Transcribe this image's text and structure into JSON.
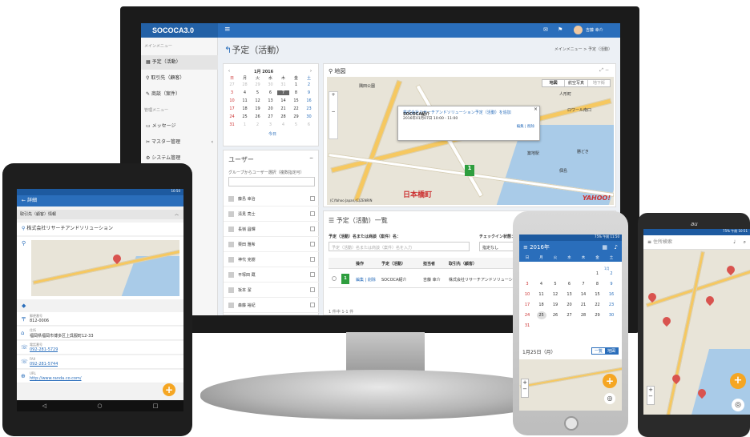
{
  "desktop": {
    "app_title": "SOCOCA3.0",
    "menu_icon": "hamburger-icon",
    "user_name": "吉藤 幸介",
    "page_title": "予定（活動）",
    "breadcrumb": "メインメニュー > 予定（活動）",
    "sidebar": {
      "section_main": "メインメニュー",
      "items": [
        {
          "icon": "calendar-icon",
          "label": "予定（活動）"
        },
        {
          "icon": "map-pin-icon",
          "label": "取引先（顧客）"
        },
        {
          "icon": "edit-icon",
          "label": "商談（案件）"
        }
      ],
      "section_admin": "管理メニュー",
      "admin_items": [
        {
          "icon": "inbox-icon",
          "label": "メッセージ"
        },
        {
          "icon": "wrench-icon",
          "label": "マスター管理"
        },
        {
          "icon": "gear-icon",
          "label": "システム管理"
        }
      ]
    },
    "calendar": {
      "month": "1月 2016",
      "weekdays": [
        "日",
        "月",
        "火",
        "水",
        "木",
        "金",
        "土"
      ],
      "weeks": [
        [
          "27",
          "28",
          "29",
          "30",
          "31",
          "1",
          "2"
        ],
        [
          "3",
          "4",
          "5",
          "6",
          "7",
          "8",
          "9"
        ],
        [
          "10",
          "11",
          "12",
          "13",
          "14",
          "15",
          "16"
        ],
        [
          "17",
          "18",
          "19",
          "20",
          "21",
          "22",
          "23"
        ],
        [
          "24",
          "25",
          "26",
          "27",
          "28",
          "29",
          "30"
        ],
        [
          "31",
          "1",
          "2",
          "3",
          "4",
          "5",
          "6"
        ]
      ],
      "today": "今日"
    },
    "users": {
      "title": "ユーザー",
      "group_label": "グループからユーザー選択（複数指定可）",
      "names": [
        "藤島 幸治",
        "清見 亮士",
        "長嶺 昌輝",
        "栗田 雅希",
        "神代 克樹",
        "平塚田 蔵",
        "坂本 潔",
        "森藤 裕紀"
      ]
    },
    "map": {
      "title": "地図",
      "map_btn": "地図",
      "satellite_btn": "航空写真",
      "terrain_btn": "地下街",
      "popup_company": "株式会社リサーチアンドソリューション予定（活動）を追加",
      "popup_time": "2016年01月07日 10:00 - 11:00",
      "popup_event": "SOCOCA紹介",
      "popup_actions": "編集 | 削除",
      "credit": "(C)Yahoo Japan,(C)ZENRIN",
      "landmark": "日本橋町",
      "brand": "YAHOO!",
      "labels": [
        "人形町",
        "ロワール南口",
        "築地駅",
        "勝どき",
        "佃島",
        "隅田公園"
      ],
      "marker_label": "1"
    },
    "list": {
      "title": "予定（活動）一覧",
      "search_label": "予定（活動）名または商談（案件）名：",
      "search_placeholder": "予定（活動）名または商談（案件）名を入力",
      "checkin_label": "チェックイン状態：",
      "checkin_value": "指定なし",
      "columns": [
        "操作",
        "予定（活動）",
        "担当者",
        "取引先（顧客）"
      ],
      "row": {
        "marker": "1",
        "actions": "編集 | 削除",
        "event": "SOCOCA紹介",
        "owner": "吉藤 幸介",
        "customer": "株式会社リサーチアンドソリューション"
      },
      "footer": "1 件中 1-1 件"
    }
  },
  "tablet": {
    "status": "10:50",
    "header": "詳細",
    "section": "取引先（顧客）情報",
    "company": "株式会社リサーチアンドソリューション",
    "fields": [
      {
        "icon": "postal-icon",
        "label": "郵便番号",
        "value": "812-0006"
      },
      {
        "icon": "address-icon",
        "label": "住所",
        "value": "福岡県福岡市博多区上呉服町12-33"
      },
      {
        "icon": "phone-icon",
        "label": "電話番号",
        "value": "092-281-5729"
      },
      {
        "icon": "fax-icon",
        "label": "FAX",
        "value": "092-281-5744"
      },
      {
        "icon": "url-icon",
        "label": "URL",
        "value": "http://www.randa.co.com/"
      }
    ]
  },
  "iphone": {
    "status": "75% 午前 11:50",
    "year": "2016年",
    "weekdays": [
      "日",
      "月",
      "火",
      "水",
      "木",
      "金",
      "土"
    ],
    "month_label": "1月",
    "weeks": [
      [
        "",
        "",
        "",
        "",
        "",
        "1",
        "2"
      ],
      [
        "3",
        "4",
        "5",
        "6",
        "7",
        "8",
        "9"
      ],
      [
        "10",
        "11",
        "12",
        "13",
        "14",
        "15",
        "16"
      ],
      [
        "17",
        "18",
        "19",
        "20",
        "21",
        "22",
        "23"
      ],
      [
        "24",
        "25",
        "26",
        "27",
        "28",
        "29",
        "30"
      ],
      [
        "31",
        "",
        "",
        "",
        "",
        "",
        ""
      ]
    ],
    "selected": "1月25日（月）",
    "toggle_list": "一覧",
    "toggle_map": "地図"
  },
  "android": {
    "carrier": "au",
    "status": "75% 午前 10:51",
    "search_placeholder": "住所検索"
  },
  "colors": {
    "primary": "#2a6ebb",
    "accent": "#f5a623",
    "green": "#2e9e3e",
    "pin": "#d9534f"
  }
}
